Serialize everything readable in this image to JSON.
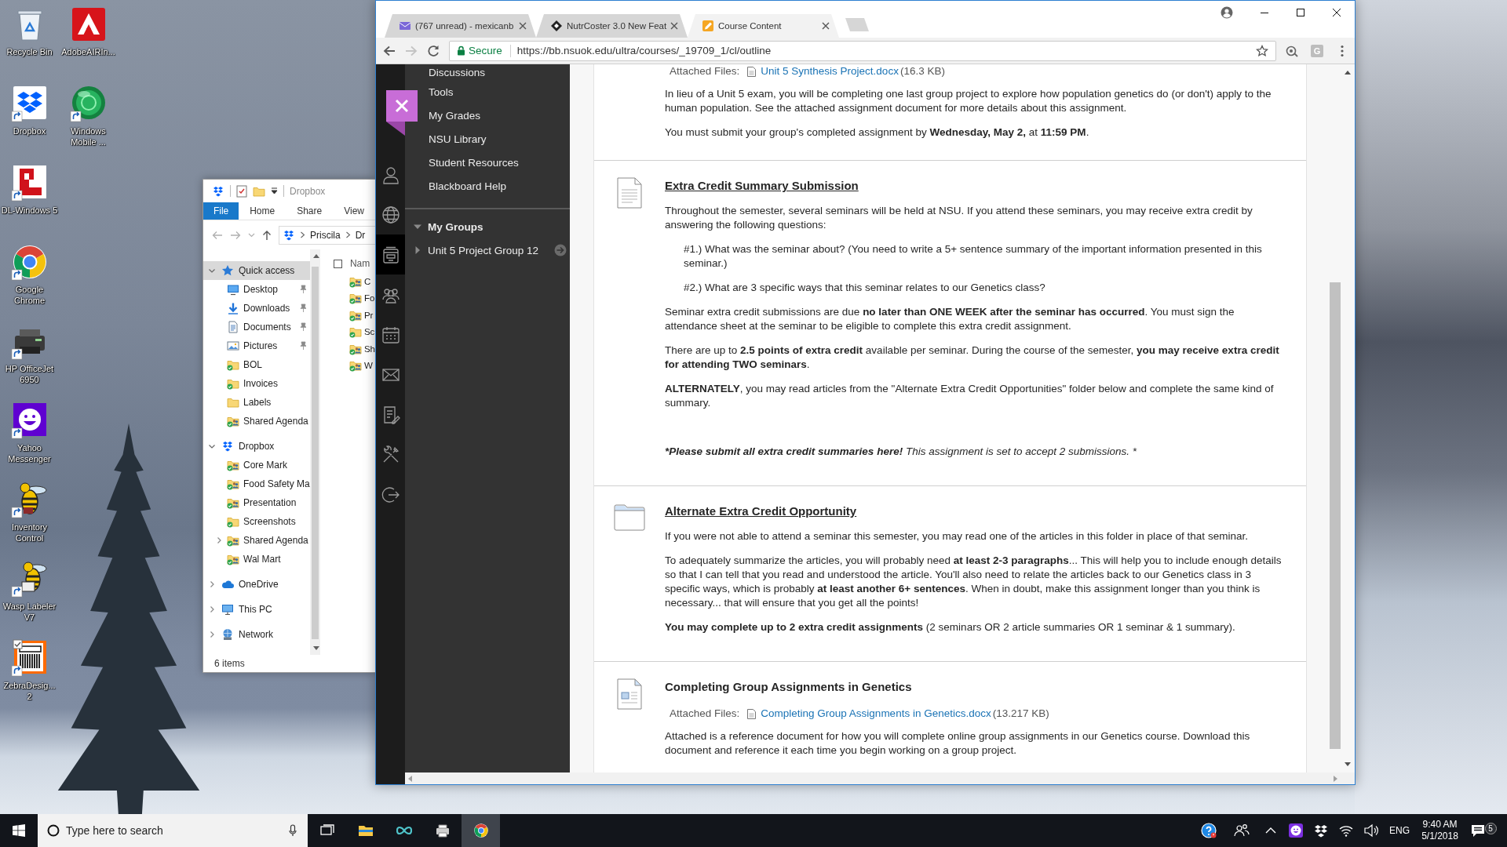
{
  "desktop": {
    "icons": [
      {
        "label": "Recycle Bin",
        "kind": "recycle-bin",
        "shortcut": false
      },
      {
        "label": "Dropbox",
        "kind": "dropbox",
        "shortcut": true
      },
      {
        "label": "DL-Windows 5",
        "kind": "dl",
        "shortcut": true
      },
      {
        "label": "Google Chrome",
        "kind": "chrome",
        "shortcut": true
      },
      {
        "label": "HP OfficeJet 6950",
        "kind": "printer",
        "shortcut": true
      },
      {
        "label": "Yahoo Messenger",
        "kind": "yahoo",
        "shortcut": true
      },
      {
        "label": "Inventory Control",
        "kind": "bee",
        "shortcut": true
      },
      {
        "label": "Wasp Labeler V7",
        "kind": "bee-printer",
        "shortcut": true
      },
      {
        "label": "ZebraDesig... 2",
        "kind": "barcode",
        "shortcut": true
      },
      {
        "label": "AdobeAIRIn...",
        "kind": "adobe-air",
        "shortcut": false
      },
      {
        "label": "Windows Mobile ...",
        "kind": "globe",
        "shortcut": true
      }
    ]
  },
  "explorer": {
    "title": "Dropbox",
    "ribbon_tabs": [
      {
        "label": "File",
        "selected": true
      },
      {
        "label": "Home",
        "selected": false
      },
      {
        "label": "Share",
        "selected": false
      },
      {
        "label": "View",
        "selected": false
      }
    ],
    "path": [
      "Priscila",
      "Dr"
    ],
    "nav": [
      {
        "label": "Quick access",
        "kind": "star",
        "expanded": true,
        "selected": true,
        "children": [
          {
            "label": "Desktop",
            "kind": "desktop",
            "pinned": true,
            "synced": false
          },
          {
            "label": "Downloads",
            "kind": "download",
            "pinned": true,
            "synced": false
          },
          {
            "label": "Documents",
            "kind": "document",
            "pinned": true,
            "synced": false
          },
          {
            "label": "Pictures",
            "kind": "pictures",
            "pinned": true,
            "synced": false
          },
          {
            "label": "BOL",
            "kind": "folder",
            "pinned": false,
            "synced": true
          },
          {
            "label": "Invoices",
            "kind": "folder",
            "pinned": false,
            "synced": true
          },
          {
            "label": "Labels",
            "kind": "folder",
            "pinned": false,
            "synced": false
          },
          {
            "label": "Shared Agenda",
            "kind": "shared-folder",
            "pinned": false,
            "synced": true
          }
        ]
      },
      {
        "label": "Dropbox",
        "kind": "dropbox",
        "expanded": true,
        "selected": false,
        "children": [
          {
            "label": "Core Mark",
            "kind": "shared-folder",
            "expandable": false,
            "synced": true
          },
          {
            "label": "Food Safety Ma",
            "kind": "shared-folder",
            "expandable": false,
            "synced": true
          },
          {
            "label": "Presentation",
            "kind": "shared-folder",
            "expandable": false,
            "synced": true
          },
          {
            "label": "Screenshots",
            "kind": "folder",
            "expandable": false,
            "synced": true
          },
          {
            "label": "Shared Agenda",
            "kind": "shared-folder",
            "expandable": true,
            "synced": true
          },
          {
            "label": "Wal Mart",
            "kind": "shared-folder",
            "expandable": false,
            "synced": true
          }
        ]
      },
      {
        "label": "OneDrive",
        "kind": "cloud",
        "expanded": false,
        "selected": false
      },
      {
        "label": "This PC",
        "kind": "pc",
        "expanded": false,
        "selected": false
      },
      {
        "label": "Network",
        "kind": "network",
        "expanded": false,
        "selected": false
      }
    ],
    "select_all": {
      "checked": false
    },
    "name_column": "Nam",
    "files": [
      {
        "name": "C",
        "kind": "shared-folder",
        "synced": true
      },
      {
        "name": "Fo",
        "kind": "shared-folder",
        "synced": true
      },
      {
        "name": "Pr",
        "kind": "shared-folder",
        "synced": true
      },
      {
        "name": "Sc",
        "kind": "folder",
        "synced": true
      },
      {
        "name": "Sh",
        "kind": "shared-folder",
        "synced": true
      },
      {
        "name": "W",
        "kind": "shared-folder",
        "synced": true
      }
    ],
    "status": "6 items"
  },
  "browser": {
    "tabs": [
      {
        "title": "(767 unread) - mexicanb",
        "kind": "mail",
        "selected": false
      },
      {
        "title": "NutrCoster 3.0 New Feat",
        "kind": "diamond",
        "selected": false
      },
      {
        "title": "Course Content",
        "kind": "pencil",
        "selected": true
      }
    ],
    "forward_disabled": true,
    "security": "Secure",
    "url": "https://bb.nsuok.edu/ultra/courses/_19709_1/cl/outline",
    "extension_letter": "G",
    "rail": [
      {
        "kind": "person",
        "selected": false
      },
      {
        "kind": "globe",
        "selected": false
      },
      {
        "kind": "courses",
        "selected": true
      },
      {
        "kind": "groups",
        "selected": false
      },
      {
        "kind": "calendar",
        "selected": false
      },
      {
        "kind": "mail",
        "selected": false
      },
      {
        "kind": "notes",
        "selected": false
      },
      {
        "kind": "tools",
        "selected": false
      },
      {
        "kind": "sign-out",
        "selected": false
      }
    ],
    "menu": [
      "Discussions",
      "Tools",
      "My Grades",
      "NSU Library",
      "Student Resources",
      "Blackboard Help"
    ],
    "groups": {
      "title": "My Groups",
      "expanded": true,
      "items": [
        {
          "label": "Unit 5 Project Group 12",
          "expanded": false
        }
      ]
    },
    "content": [
      {
        "attachment": {
          "label": "Attached Files:",
          "file": "Unit 5 Synthesis Project.docx",
          "size": "(16.3 KB)"
        },
        "blocks": [
          {
            "kind": "paragraph",
            "text": "In lieu of a Unit 5 exam, you will be completing one last group project to explore how population genetics do (or don't) apply to the human population. See the attached assignment document for more details about this assignment."
          },
          {
            "kind": "paragraph",
            "text": "You must submit your group's completed assignment by **Wednesday, May 2,** at **11:59 PM**."
          }
        ]
      },
      {
        "kind": "assignment",
        "title": "Extra Credit Summary Submission",
        "linked": true,
        "blocks": [
          {
            "kind": "paragraph",
            "text": "Throughout the semester, several seminars will be held at NSU. If you attend these seminars, you may receive extra credit by answering the following questions:"
          },
          {
            "kind": "indented",
            "text": "#1.) What was the seminar about? (You need to write a 5+ sentence summary of the important information presented in this seminar.)"
          },
          {
            "kind": "indented",
            "text": "#2.) What are 3 specific ways that this seminar relates to our Genetics class?"
          },
          {
            "kind": "paragraph",
            "text": "Seminar extra credit submissions are due **no later than ONE WEEK after the seminar has occurred**. You must sign the attendance sheet at the seminar to be eligible to complete this extra credit assignment."
          },
          {
            "kind": "paragraph",
            "text": "There are up to **2.5 points of extra credit** available per seminar. During the course of the semester, **you may receive extra credit for attending TWO seminars**."
          },
          {
            "kind": "paragraph",
            "text": "**ALTERNATELY**, you may read articles from the \"Alternate Extra Credit Opportunities\" folder below and complete the same kind of summary."
          },
          {
            "kind": "note",
            "bold": "*Please submit all extra credit summaries here!",
            "text": "This assignment is set to accept 2 submissions. *"
          }
        ]
      },
      {
        "kind": "folder",
        "title": "Alternate Extra Credit Opportunity",
        "linked": true,
        "blocks": [
          {
            "kind": "paragraph",
            "text": "If you were not able to attend a seminar this semester, you may read one of the articles in this folder in place of that seminar."
          },
          {
            "kind": "paragraph",
            "text": "To adequately summarize the articles, you will probably need **at least 2-3 paragraphs**... This will help you to include enough details so that I can tell that you read and understood the article. You'll also need to relate the articles back to our Genetics class in 3 specific ways, which is probably **at least another 6+ sentences**. When in doubt, make this assignment longer than you think is necessary... that will ensure that you get all the points!"
          },
          {
            "kind": "paragraph",
            "text": "**You may complete up to 2 extra credit assignments** (2 seminars OR 2 article summaries OR 1 seminar & 1 summary)."
          }
        ]
      },
      {
        "kind": "document",
        "title": "Completing Group Assignments in Genetics",
        "linked": false,
        "attachment": {
          "label": "Attached Files:",
          "file": "Completing Group Assignments in Genetics.docx",
          "size": "(13.217 KB)"
        },
        "blocks": [
          {
            "kind": "paragraph",
            "text": "Attached is a reference document for how you will complete online group assignments in our Genetics course. Download this document and reference it each time you begin working on a group project."
          }
        ]
      }
    ]
  },
  "taskbar": {
    "search": {
      "placeholder": "Type here to search"
    },
    "apps": [
      {
        "kind": "task-view",
        "active": false
      },
      {
        "kind": "file-explorer",
        "active": false
      },
      {
        "kind": "infinity",
        "active": false
      },
      {
        "kind": "printer",
        "active": false
      },
      {
        "kind": "chrome",
        "active": true
      }
    ],
    "tray": [
      {
        "kind": "help"
      },
      {
        "kind": "people"
      },
      {
        "kind": "chevron-up"
      },
      {
        "kind": "yahoo"
      },
      {
        "kind": "dropbox"
      },
      {
        "kind": "wifi"
      },
      {
        "kind": "volume"
      }
    ],
    "language": "ENG",
    "time": "9:40 AM",
    "date": "5/1/2018",
    "notifications": "5"
  }
}
